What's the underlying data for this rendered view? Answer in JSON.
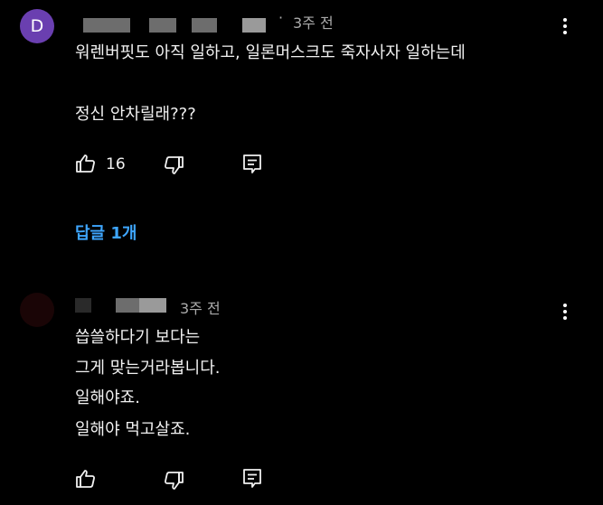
{
  "comments": [
    {
      "avatar_letter": "D",
      "time": "3주 전",
      "text_lines": [
        "워렌버핏도 아직 일하고, 일론머스크도 죽자사자 일하는데",
        "정신 안차릴래???"
      ],
      "like_count": "16",
      "replies_label": "답글 1개"
    },
    {
      "time": "3주 전",
      "text_lines": [
        "씁쓸하다기 보다는",
        "그게 맞는거라봅니다.",
        "일해야죠.",
        "일해야 먹고살죠."
      ]
    }
  ],
  "icons": {
    "like": "thumbs-up-icon",
    "dislike": "thumbs-down-icon",
    "reply": "reply-comment-icon",
    "more": "more-vertical-icon"
  },
  "colors": {
    "background": "#000000",
    "avatar_d": "#6a3fb0",
    "replies_link": "#3ea6ff",
    "meta_text": "#aaaaaa"
  }
}
